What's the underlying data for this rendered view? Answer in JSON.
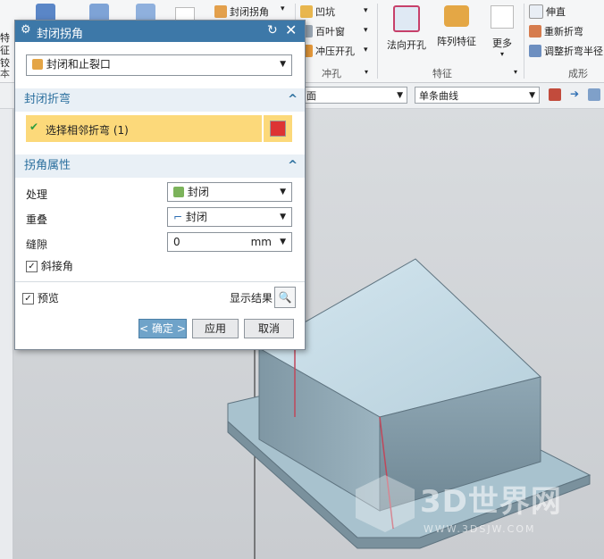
{
  "ribbon": {
    "left_partial": {
      "line1": "特征",
      "line2": "铰"
    },
    "group_blank_label": "本",
    "col1": {
      "item1": "封闭拐角"
    },
    "stamp_group": {
      "items": [
        "凹坑",
        "百叶窗",
        "冲压开孔"
      ],
      "label": "冲孔"
    },
    "feature_group": {
      "btn1": "法向开孔",
      "btn2": "阵列特征",
      "btn3": "更多",
      "label": "特征"
    },
    "form_group": {
      "items": [
        "伸直",
        "重新折弯",
        "调整折弯半径"
      ],
      "label": "成形"
    }
  },
  "toolbar2": {
    "combo1": "面",
    "combo2": "单条曲线"
  },
  "dialog": {
    "title": "封闭拐角",
    "type_dropdown": "封闭和止裂口",
    "section1": {
      "title": "封闭折弯",
      "select_label": "选择相邻折弯 (1)"
    },
    "section2": {
      "title": "拐角属性",
      "treat_label": "处理",
      "treat_value": "封闭",
      "overlap_label": "重叠",
      "overlap_value": "封闭",
      "gap_label": "缝隙",
      "gap_value": "0",
      "gap_unit": "mm",
      "miter_label": "斜接角"
    },
    "preview_label": "预览",
    "show_result_label": "显示结果",
    "ok_label": "< 确定 >",
    "apply_label": "应用",
    "cancel_label": "取消"
  },
  "watermark": {
    "brand": "3D世界网",
    "url": "WWW.3DSJW.COM"
  },
  "colors": {
    "title_bar": "#3d78a8",
    "section_text": "#2b6f9e",
    "selection_bar": "#fcd97a",
    "ok_button": "#6fa3c9"
  }
}
